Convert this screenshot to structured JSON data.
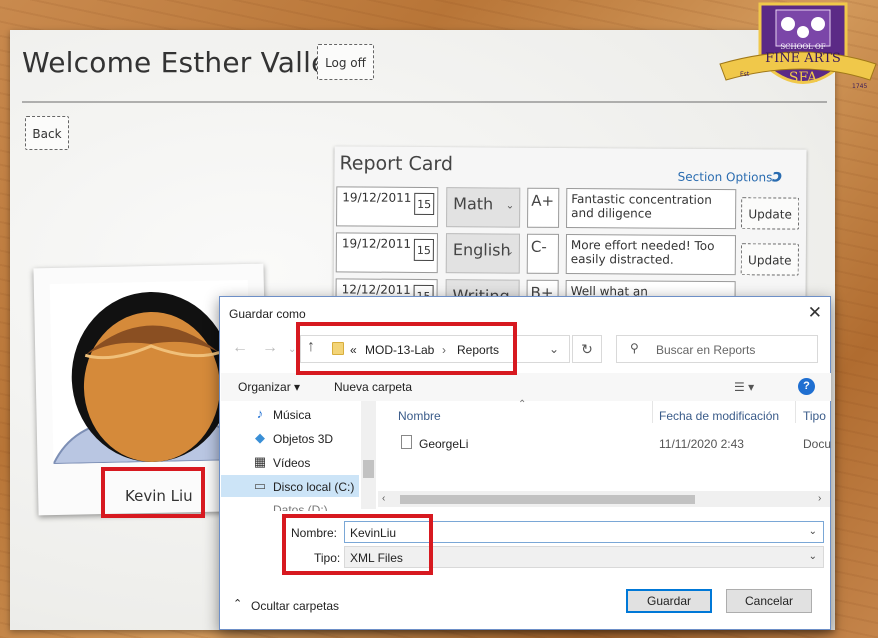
{
  "app": {
    "welcome": "Welcome Esther Valle!",
    "logoff_label": "Log off",
    "back_label": "Back",
    "logo": {
      "text_top": "SCHOOL OF",
      "text_main": "FINE ARTS",
      "text_abbr": "SFA",
      "est": "Est",
      "year": "1745"
    }
  },
  "report_card": {
    "title": "Report Card",
    "section_options": "Section Options",
    "update_label": "Update",
    "rows": [
      {
        "date": "19/12/2011",
        "day": "15",
        "subject": "Math",
        "grade": "A+",
        "comment": "Fantastic concentration and diligence"
      },
      {
        "date": "19/12/2011",
        "day": "15",
        "subject": "English",
        "grade": "C-",
        "comment": "More effort needed! Too easily distracted."
      },
      {
        "date": "12/12/2011",
        "day": "15",
        "subject": "Writing",
        "grade": "B+",
        "comment": "Well what an improvement."
      }
    ]
  },
  "student": {
    "name": "Kevin Liu"
  },
  "dialog": {
    "title": "Guardar como",
    "breadcrumb": [
      "«",
      "MOD-13-Lab",
      "›",
      "Reports"
    ],
    "search_placeholder": "Buscar en Reports",
    "organize": "Organizar ▾",
    "new_folder": "Nueva carpeta",
    "nav_items": [
      {
        "label": "Música",
        "icon": "music-icon"
      },
      {
        "label": "Objetos 3D",
        "icon": "cube-icon"
      },
      {
        "label": "Vídeos",
        "icon": "film-icon"
      },
      {
        "label": "Disco local (C:)",
        "icon": "drive-icon"
      },
      {
        "label": "Datos (D:)",
        "icon": "drive-icon"
      }
    ],
    "columns": {
      "name": "Nombre",
      "modified": "Fecha de modificación",
      "type": "Tipo"
    },
    "files": [
      {
        "name": "GeorgeLi",
        "modified": "11/11/2020 2:43",
        "type": "Docu"
      }
    ],
    "filename_label": "Nombre:",
    "filename_value": "KevinLiu",
    "filetype_label": "Tipo:",
    "filetype_value": "XML Files",
    "hide_folders": "Ocultar carpetas",
    "save_label": "Guardar",
    "cancel_label": "Cancelar"
  },
  "colors": {
    "highlight": "#d71920",
    "accent": "#0078d7",
    "link": "#2a6cb0"
  }
}
